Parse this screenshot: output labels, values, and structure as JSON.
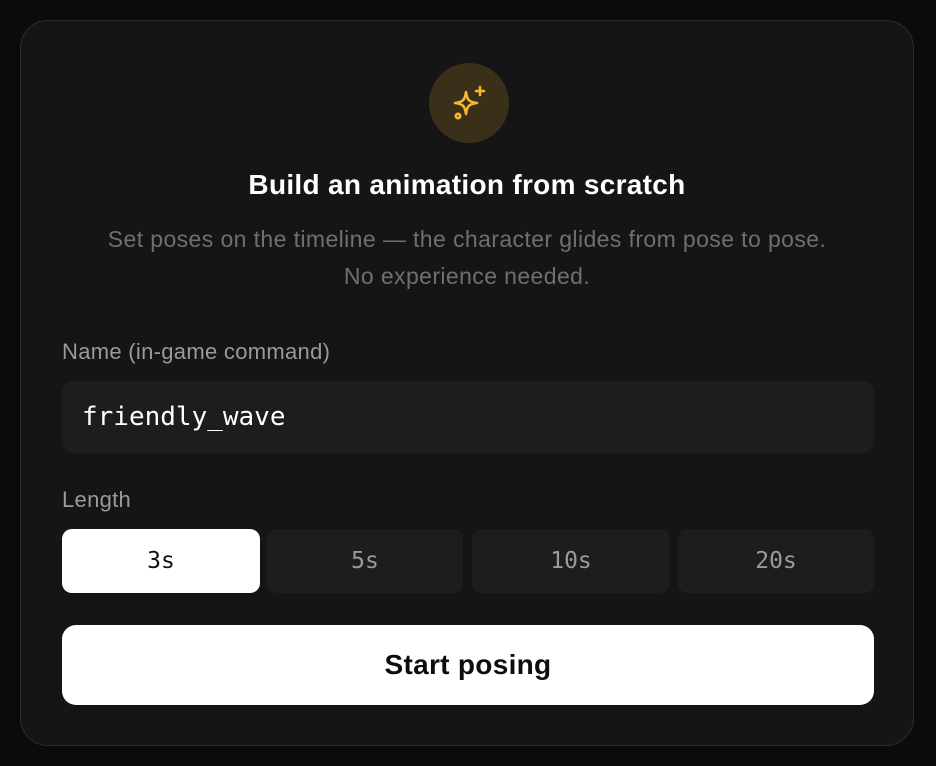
{
  "header": {
    "icon": "sparkles-icon",
    "icon_color": "#f5b82e",
    "title": "Build an animation from scratch",
    "subtitle_line1": "Set poses on the timeline — the character glides from pose to pose.",
    "subtitle_line2": "No experience needed."
  },
  "form": {
    "name_label": "Name (in-game command)",
    "name_value": "friendly_wave",
    "length_label": "Length",
    "length_options": [
      {
        "label": "3s",
        "selected": true
      },
      {
        "label": "5s",
        "selected": false
      },
      {
        "label": "10s",
        "selected": false
      },
      {
        "label": "20s",
        "selected": false
      }
    ],
    "submit_label": "Start posing"
  }
}
